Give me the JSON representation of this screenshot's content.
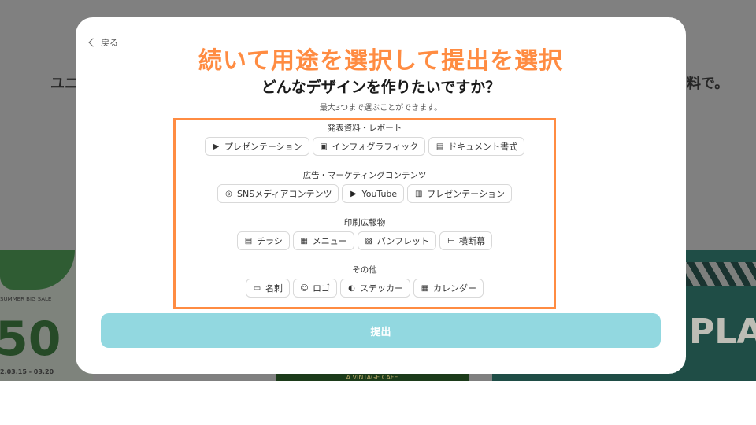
{
  "background": {
    "left_fragment": "ユニ",
    "right_fragment": "料で。",
    "thumb_sale": "SUMMER BIG SALE",
    "thumb_percent": "50",
    "thumb_date": "2.03.15 - 03.20",
    "thumb_cafe": "A VINTAGE CAFE",
    "thumb_plan": "PLAN"
  },
  "modal": {
    "back_label": "戻る",
    "annotation": "続いて用途を選択して提出を選択",
    "title": "どんなデザインを作りたいですか？",
    "subtitle": "最大3つまで選ぶことができます。",
    "categories": [
      {
        "label": "発表資料・レポート",
        "options": [
          {
            "label": "プレゼンテーション",
            "icon": "play-icon"
          },
          {
            "label": "インフォグラフィック",
            "icon": "image-icon"
          },
          {
            "label": "ドキュメント書式",
            "icon": "document-icon"
          }
        ]
      },
      {
        "label": "広告・マーケティングコンテンツ",
        "options": [
          {
            "label": "SNSメディアコンテンツ",
            "icon": "instagram-icon"
          },
          {
            "label": "YouTube",
            "icon": "youtube-icon"
          },
          {
            "label": "プレゼンテーション",
            "icon": "presentation-icon"
          }
        ]
      },
      {
        "label": "印刷広報物",
        "options": [
          {
            "label": "チラシ",
            "icon": "flyer-icon"
          },
          {
            "label": "メニュー",
            "icon": "menu-icon"
          },
          {
            "label": "パンフレット",
            "icon": "pamphlet-icon"
          },
          {
            "label": "横断幕",
            "icon": "banner-icon"
          }
        ]
      },
      {
        "label": "その他",
        "options": [
          {
            "label": "名刺",
            "icon": "card-icon"
          },
          {
            "label": "ロゴ",
            "icon": "smile-icon"
          },
          {
            "label": "ステッカー",
            "icon": "sticker-icon"
          },
          {
            "label": "カレンダー",
            "icon": "calendar-icon"
          }
        ]
      }
    ],
    "submit_label": "提出"
  },
  "colors": {
    "accent": "#ff8c42",
    "submit": "#92d8e0",
    "overlay": "#808080"
  }
}
